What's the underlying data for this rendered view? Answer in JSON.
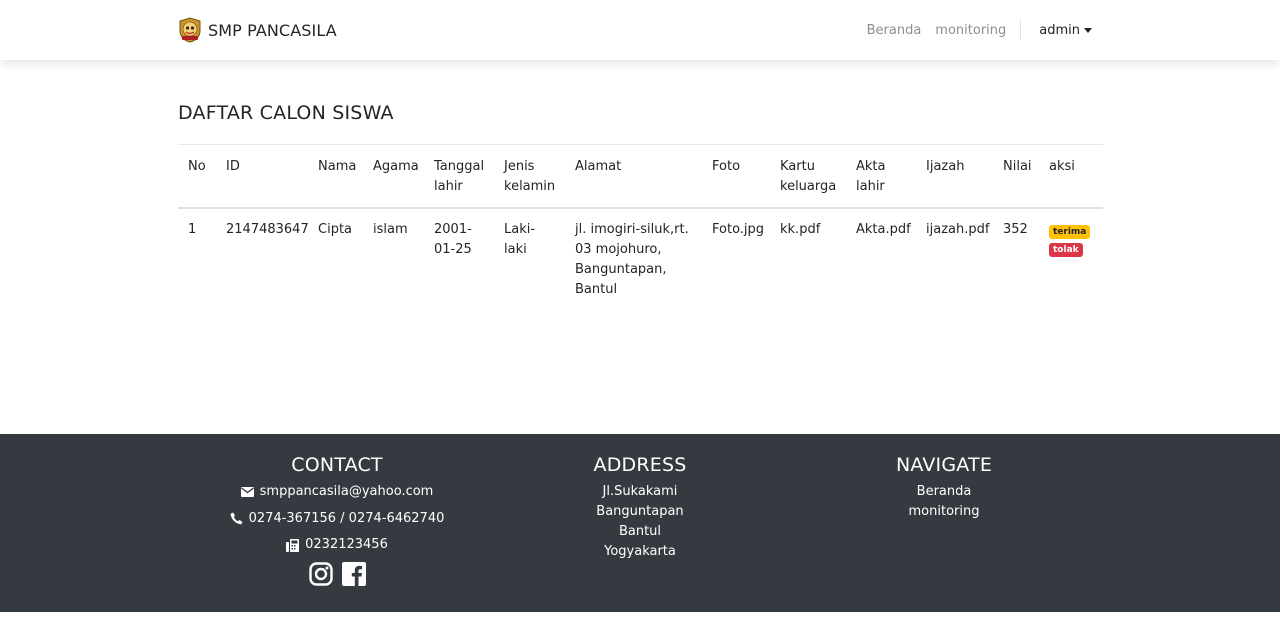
{
  "navbar": {
    "brand": "SMP PANCASILA",
    "links": [
      "Beranda",
      "monitoring"
    ],
    "user": "admin"
  },
  "main": {
    "title": "DAFTAR CALON SISWA",
    "columns": [
      "No",
      "ID",
      "Nama",
      "Agama",
      "Tanggal lahir",
      "Jenis kelamin",
      "Alamat",
      "Foto",
      "Kartu keluarga",
      "Akta lahir",
      "Ijazah",
      "Nilai",
      "aksi"
    ],
    "rows": [
      {
        "no": "1",
        "id": "2147483647",
        "nama": "Cipta",
        "agama": "islam",
        "tanggal_lahir": "2001-01-25",
        "jenis_kelamin": "Laki-laki",
        "alamat": "jl. imogiri-siluk,rt. 03 mojohuro, Banguntapan, Bantul",
        "foto": "Foto.jpg",
        "kartu_keluarga": "kk.pdf",
        "akta_lahir": "Akta.pdf",
        "ijazah": "ijazah.pdf",
        "nilai": "352",
        "accept_label": "terima",
        "reject_label": "tolak"
      }
    ]
  },
  "footer": {
    "contact": {
      "title": "CONTACT",
      "email": "smppancasila@yahoo.com",
      "phone": "0274-367156 / 0274-6462740",
      "fax": "0232123456"
    },
    "address": {
      "title": "ADDRESS",
      "lines": [
        "Jl.Sukakami",
        "Banguntapan",
        "Bantul",
        "Yogyakarta"
      ]
    },
    "navigate": {
      "title": "NAVIGATE",
      "links": [
        "Beranda",
        "monitoring"
      ]
    }
  },
  "colors": {
    "footer_bg": "#343a40",
    "badge_accept": "#ffc107",
    "badge_reject": "#dc3545"
  },
  "icons": [
    "school-logo-icon",
    "envelope-icon",
    "phone-icon",
    "fax-icon",
    "instagram-icon",
    "facebook-icon",
    "caret-down-icon"
  ]
}
